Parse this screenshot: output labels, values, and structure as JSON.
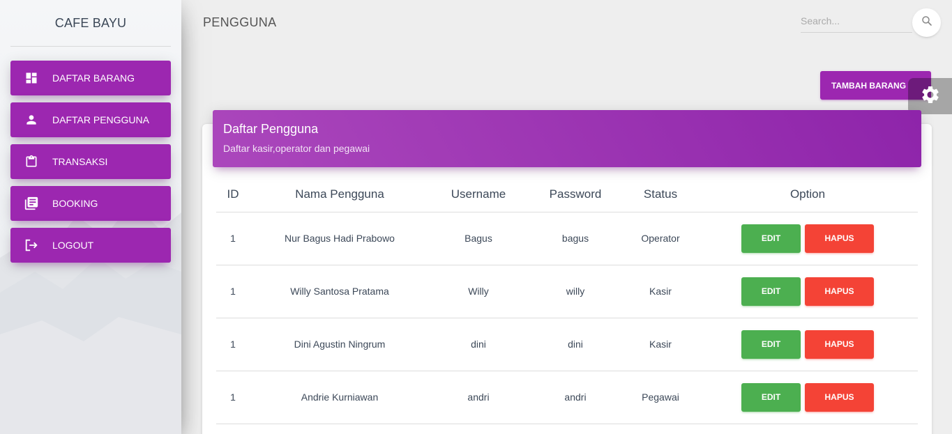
{
  "brand": {
    "name": "CAFE BAYU"
  },
  "sidebar": {
    "items": [
      {
        "label": "DAFTAR BARANG",
        "icon": "dashboard-icon"
      },
      {
        "label": "DAFTAR PENGGUNA",
        "icon": "person-icon"
      },
      {
        "label": "TRANSAKSI",
        "icon": "clipboard-icon"
      },
      {
        "label": "BOOKING",
        "icon": "library-books-icon"
      },
      {
        "label": "LOGOUT",
        "icon": "logout-icon"
      }
    ]
  },
  "header": {
    "title": "PENGGUNA",
    "search": {
      "placeholder": "Search...",
      "value": "",
      "icon": "search-icon"
    }
  },
  "toolbar": {
    "add_label": "TAMBAH BARANG",
    "settings_icon": "gear-icon"
  },
  "card": {
    "title": "Daftar Pengguna",
    "subtitle": "Daftar kasir,operator dan pegawai"
  },
  "table": {
    "columns": [
      "ID",
      "Nama Pengguna",
      "Username",
      "Password",
      "Status",
      "Option"
    ],
    "rows": [
      {
        "id": "1",
        "name": "Nur Bagus Hadi Prabowo",
        "username": "Bagus",
        "password": "bagus",
        "status": "Operator"
      },
      {
        "id": "1",
        "name": "Willy Santosa Pratama",
        "username": "Willy",
        "password": "willy",
        "status": "Kasir"
      },
      {
        "id": "1",
        "name": "Dini Agustin Ningrum",
        "username": "dini",
        "password": "dini",
        "status": "Kasir"
      },
      {
        "id": "1",
        "name": "Andrie Kurniawan",
        "username": "andri",
        "password": "andri",
        "status": "Pegawai"
      }
    ],
    "edit_label": "EDIT",
    "delete_label": "HAPUS"
  },
  "colors": {
    "primary": "#9c27b0",
    "success": "#4caf50",
    "danger": "#f44336",
    "background": "#eeeeee"
  }
}
